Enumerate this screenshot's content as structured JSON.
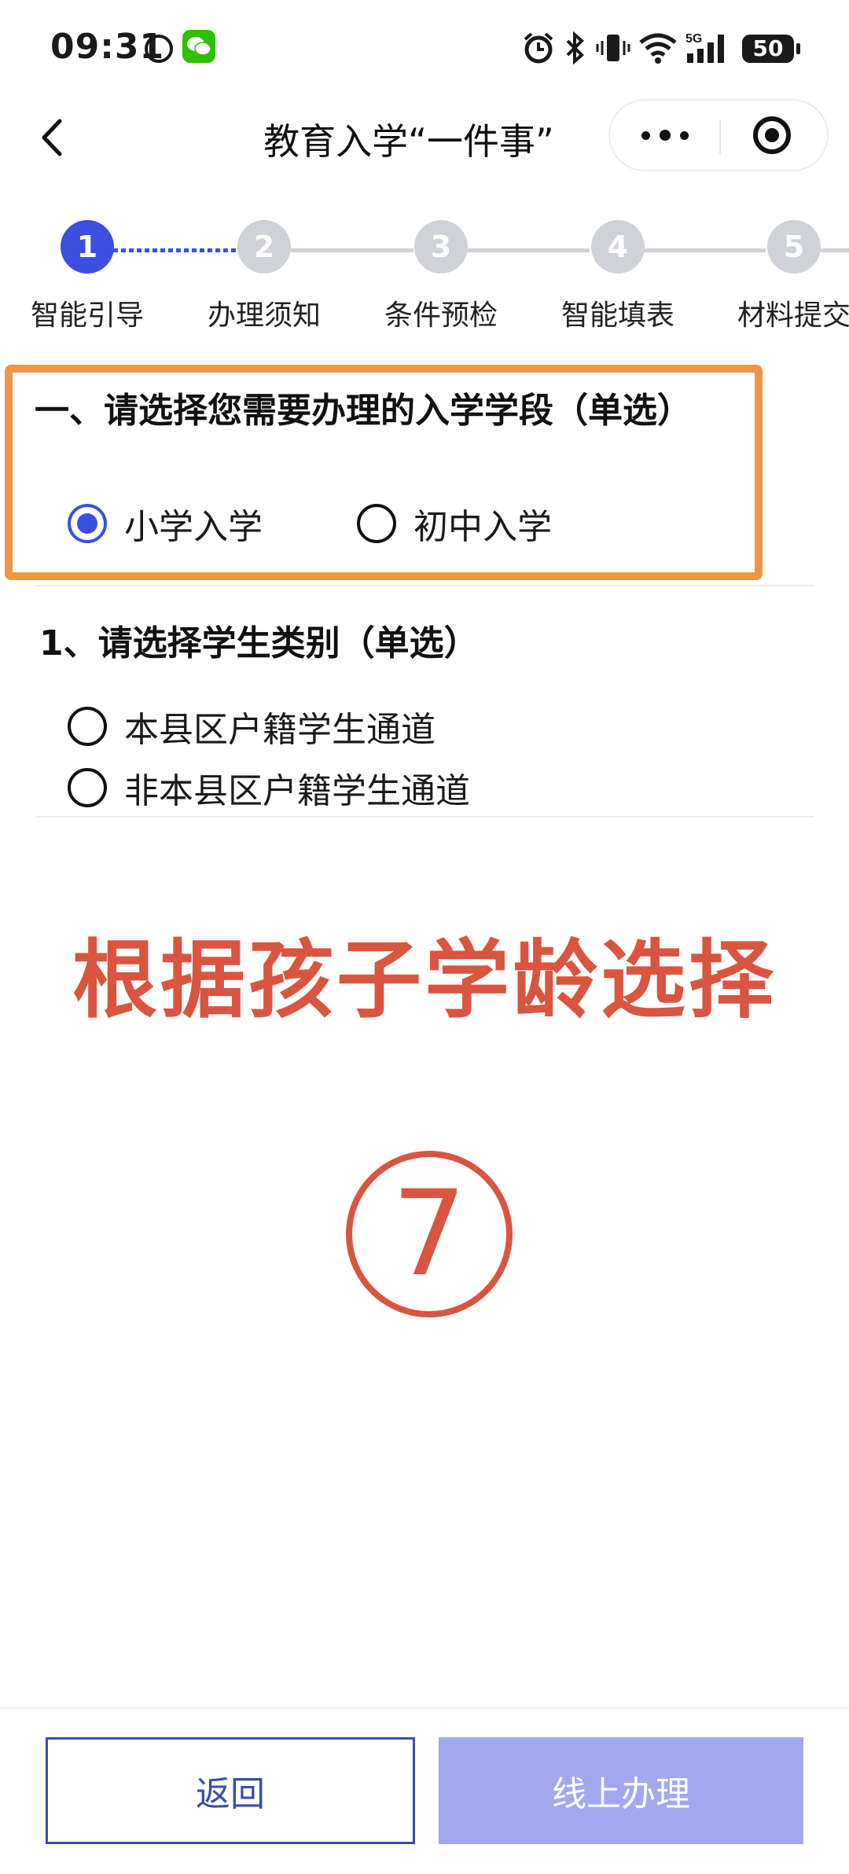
{
  "status_bar": {
    "time": "09:31",
    "battery": "50"
  },
  "nav": {
    "title": "教育入学“一件事”"
  },
  "steps": [
    {
      "num": "1",
      "label": "智能引导",
      "active": true
    },
    {
      "num": "2",
      "label": "办理须知",
      "active": false
    },
    {
      "num": "3",
      "label": "条件预检",
      "active": false
    },
    {
      "num": "4",
      "label": "智能填表",
      "active": false
    },
    {
      "num": "5",
      "label": "材料提交",
      "active": false
    }
  ],
  "section1": {
    "title": "一、请选择您需要办理的入学学段（单选）",
    "options": [
      {
        "label": "小学入学",
        "checked": true
      },
      {
        "label": "初中入学",
        "checked": false
      }
    ]
  },
  "question1": {
    "title": "1、请选择学生类别（单选）",
    "options": [
      {
        "label": "本县区户籍学生通道",
        "checked": false
      },
      {
        "label": "非本县区户籍学生通道",
        "checked": false
      }
    ]
  },
  "annotation": {
    "text": "根据孩子学龄选择",
    "number": "7"
  },
  "buttons": {
    "back": "返回",
    "online": "线上办理"
  },
  "colors": {
    "accent": "#3b4fe0",
    "highlight": "#ef9548",
    "annotation": "#d9553f",
    "disabled_button": "#a3a8ee"
  }
}
